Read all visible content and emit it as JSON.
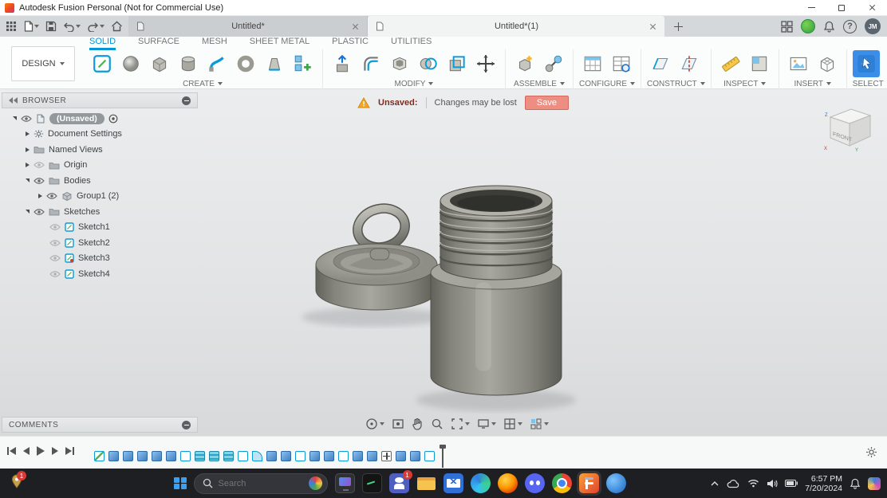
{
  "titlebar": {
    "title": "Autodesk Fusion Personal (Not for Commercial Use)"
  },
  "tabbar": {
    "documents": [
      {
        "label": "Untitled*"
      },
      {
        "label": "Untitled*(1)"
      }
    ],
    "user_initials": "JM"
  },
  "ribbon": {
    "design_label": "DESIGN",
    "tabs": [
      "SOLID",
      "SURFACE",
      "MESH",
      "SHEET METAL",
      "PLASTIC",
      "UTILITIES"
    ],
    "active_tab": "SOLID",
    "groups": [
      "CREATE",
      "MODIFY",
      "ASSEMBLE",
      "CONFIGURE",
      "CONSTRUCT",
      "INSPECT",
      "INSERT",
      "SELECT"
    ],
    "accent_color": "#0696d7"
  },
  "notification": {
    "title": "Unsaved:",
    "message": "Changes may be lost",
    "save_label": "Save"
  },
  "browser": {
    "header": "BROWSER",
    "rows": [
      {
        "label": "(Unsaved)"
      },
      {
        "label": "Document Settings"
      },
      {
        "label": "Named Views"
      },
      {
        "label": "Origin"
      },
      {
        "label": "Bodies"
      },
      {
        "label": "Group1 (2)"
      },
      {
        "label": "Sketches"
      },
      {
        "label": "Sketch1"
      },
      {
        "label": "Sketch2"
      },
      {
        "label": "Sketch3"
      },
      {
        "label": "Sketch4"
      }
    ]
  },
  "comments": {
    "header": "COMMENTS"
  },
  "viewcube": {
    "front_label": "FRONT",
    "axis_x": "X",
    "axis_y": "Y",
    "axis_z": "Z"
  },
  "timeline": {
    "features": [
      "sketch-pencil",
      "feature",
      "feature",
      "feature",
      "feature",
      "feature",
      "sketch",
      "layers",
      "layers",
      "layers",
      "sketch",
      "sweep",
      "feature",
      "feature",
      "sketch",
      "feature",
      "feature",
      "sketch",
      "feature",
      "feature",
      "move",
      "feature",
      "feature",
      "sketch"
    ]
  },
  "taskbar": {
    "search_placeholder": "Search",
    "clock": {
      "time": "6:57 PM",
      "date": "7/20/2024"
    },
    "badges": {
      "app": "1",
      "pin": "1"
    }
  }
}
